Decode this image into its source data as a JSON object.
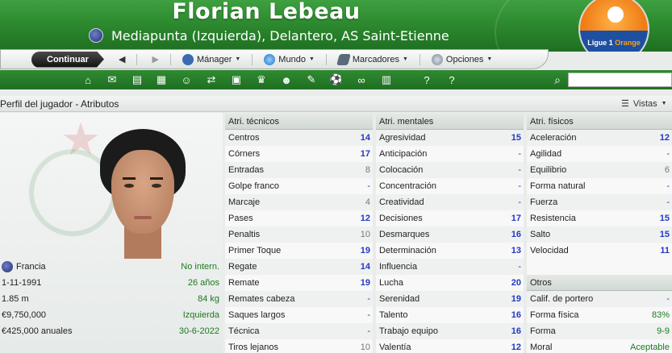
{
  "header": {
    "player_name": "Florian Lebeau",
    "subtitle": "Mediapunta (Izquierda), Delantero, AS Saint-Etienne",
    "league_logo_text": "Ligue 1",
    "league_logo_sponsor": "Orange"
  },
  "toolbar": {
    "continue_label": "Continuar",
    "menus": [
      {
        "label": "Mánager",
        "icon": "manager-icon",
        "color": "#3a6ab0"
      },
      {
        "label": "Mundo",
        "icon": "globe-icon",
        "color": "#3a8ad0"
      },
      {
        "label": "Marcadores",
        "icon": "bookmark-icon",
        "color": "#5a6a7a"
      },
      {
        "label": "Opciones",
        "icon": "options-icon",
        "color": "#7a8a9a"
      }
    ]
  },
  "iconbar": {
    "icons": [
      "home-icon",
      "inbox-icon",
      "news-icon",
      "calendar-icon",
      "squad-icon",
      "transfers-icon",
      "tactics-icon",
      "trophy-icon",
      "staff-icon",
      "notes-icon",
      "match-icon",
      "scout-icon",
      "finance-icon",
      "help-icon",
      "info-icon"
    ]
  },
  "panel": {
    "title": "Perfil del jugador - Atributos",
    "views_label": "Vistas"
  },
  "profile": {
    "nationality": "Francia",
    "nationality_value": "No intern.",
    "birthdate": "1-11-1991",
    "age": "26 años",
    "height": "1.85 m",
    "weight": "84 kg",
    "value": "€9,750,000",
    "foot": "Izquierda",
    "wage": "€425,000 anuales",
    "contract_end": "30-6-2022"
  },
  "technical": {
    "title": "Atri. técnicos",
    "rows": [
      {
        "name": "Centros",
        "value": "14",
        "style": "blue"
      },
      {
        "name": "Córners",
        "value": "17",
        "style": "blue"
      },
      {
        "name": "Entradas",
        "value": "8",
        "style": "gray"
      },
      {
        "name": "Golpe franco",
        "value": "-",
        "style": "dash"
      },
      {
        "name": "Marcaje",
        "value": "4",
        "style": "gray"
      },
      {
        "name": "Pases",
        "value": "12",
        "style": "blue"
      },
      {
        "name": "Penaltis",
        "value": "10",
        "style": "gray"
      },
      {
        "name": "Primer Toque",
        "value": "19",
        "style": "blue"
      },
      {
        "name": "Regate",
        "value": "14",
        "style": "blue"
      },
      {
        "name": "Remate",
        "value": "19",
        "style": "blue"
      },
      {
        "name": "Remates cabeza",
        "value": "-",
        "style": "dash"
      },
      {
        "name": "Saques largos",
        "value": "-",
        "style": "dash"
      },
      {
        "name": "Técnica",
        "value": "-",
        "style": "dash"
      },
      {
        "name": "Tiros lejanos",
        "value": "10",
        "style": "gray"
      }
    ]
  },
  "mental": {
    "title": "Atri. mentales",
    "rows": [
      {
        "name": "Agresividad",
        "value": "15",
        "style": "blue"
      },
      {
        "name": "Anticipación",
        "value": "-",
        "style": "dash"
      },
      {
        "name": "Colocación",
        "value": "-",
        "style": "dash"
      },
      {
        "name": "Concentración",
        "value": "-",
        "style": "dash"
      },
      {
        "name": "Creatividad",
        "value": "-",
        "style": "dash"
      },
      {
        "name": "Decisiones",
        "value": "17",
        "style": "blue"
      },
      {
        "name": "Desmarques",
        "value": "16",
        "style": "blue"
      },
      {
        "name": "Determinación",
        "value": "13",
        "style": "blue"
      },
      {
        "name": "Influencia",
        "value": "-",
        "style": "dash"
      },
      {
        "name": "Lucha",
        "value": "20",
        "style": "blue"
      },
      {
        "name": "Serenidad",
        "value": "19",
        "style": "blue"
      },
      {
        "name": "Talento",
        "value": "16",
        "style": "blue"
      },
      {
        "name": "Trabajo equipo",
        "value": "16",
        "style": "blue"
      },
      {
        "name": "Valentía",
        "value": "12",
        "style": "blue"
      }
    ]
  },
  "physical": {
    "title": "Atri. físicos",
    "rows": [
      {
        "name": "Aceleración",
        "value": "12",
        "style": "blue"
      },
      {
        "name": "Agilidad",
        "value": "-",
        "style": "dash"
      },
      {
        "name": "Equilibrio",
        "value": "6",
        "style": "gray"
      },
      {
        "name": "Forma natural",
        "value": "-",
        "style": "dash"
      },
      {
        "name": "Fuerza",
        "value": "-",
        "style": "dash"
      },
      {
        "name": "Resistencia",
        "value": "15",
        "style": "blue"
      },
      {
        "name": "Salto",
        "value": "15",
        "style": "blue"
      },
      {
        "name": "Velocidad",
        "value": "11",
        "style": "blue"
      }
    ]
  },
  "other": {
    "title": "Otros",
    "rows": [
      {
        "name": "Calif. de portero",
        "value": "-",
        "style": "dash"
      },
      {
        "name": "Forma física",
        "value": "83%",
        "style": "green"
      },
      {
        "name": "Forma",
        "value": "9-9",
        "style": "green"
      },
      {
        "name": "Moral",
        "value": "Aceptable",
        "style": "green"
      }
    ]
  }
}
